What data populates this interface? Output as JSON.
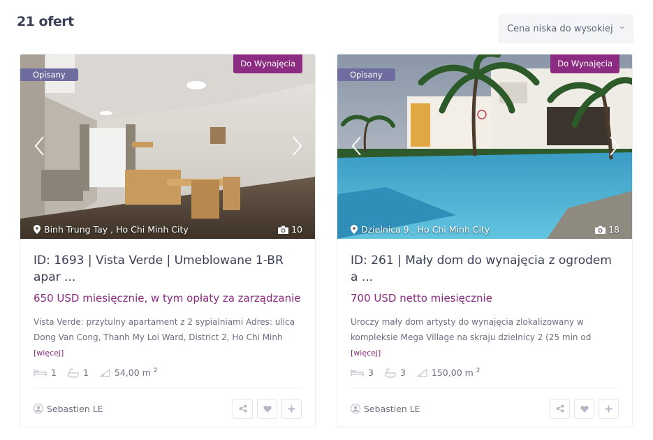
{
  "header": {
    "results_count": "21 ofert",
    "sort_value": "Cena niska do wysokiej"
  },
  "colors": {
    "accent": "#8b2c82",
    "label": "#6f6ca0"
  },
  "listings": [
    {
      "label": "Opisany",
      "status": "Do Wynajęcia",
      "location": "Binh Trung Tay , Ho Chi Minh City",
      "photo_count": "10",
      "title_line1": "ID: 1693 | Vista Verde | Umeblowane 1-BR",
      "title_line2": "apar ...",
      "price": "650 USD miesięcznie, w tym opłaty za zarządzanie",
      "description": "Vista Verde: przytulny apartament z 2 sypialniami Adres: ulica Dong Van Cong, Thanh My Loi Ward, District 2, Ho Chi Minh",
      "more": "[więcej]",
      "beds": "1",
      "baths": "1",
      "area": "54,00 m",
      "area_sup": "2",
      "agent": "Sebastien LE"
    },
    {
      "label": "Opisany",
      "status": "Do Wynajęcia",
      "location": "Dzielnica 9 , Ho Chi Minh City",
      "photo_count": "18",
      "title_line1": "ID: 261 | Mały dom do wynajęcia z ogrodem",
      "title_line2": "a ...",
      "price": "700 USD netto miesięcznie",
      "description": "Uroczy mały dom artysty do wynajęcia zlokalizowany w kompleksie Mega Village na skraju dzielnicy 2 (25 min od",
      "more": "[więcej]",
      "beds": "3",
      "baths": "3",
      "area": "150,00 m",
      "area_sup": "2",
      "agent": "Sebastien LE"
    }
  ]
}
